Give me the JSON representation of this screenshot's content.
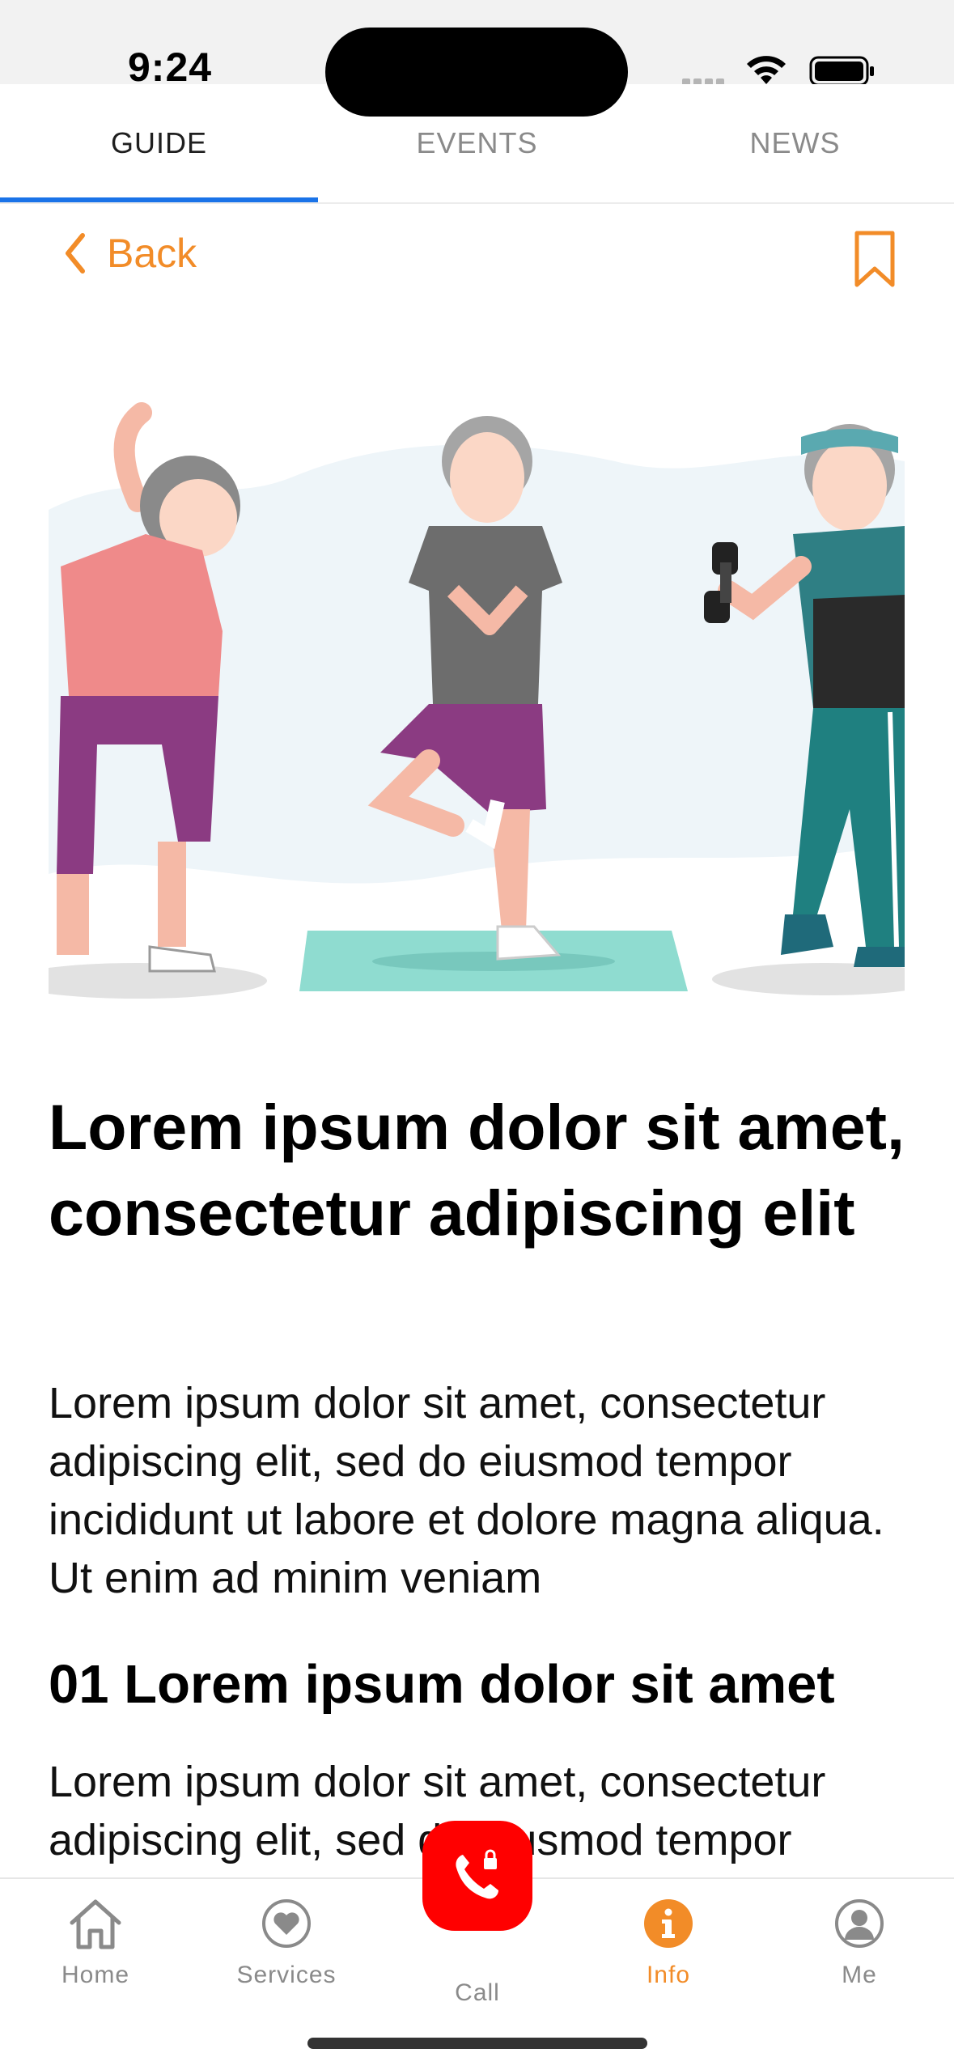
{
  "status_bar": {
    "time": "9:24"
  },
  "top_tabs": [
    {
      "label": "GUIDE",
      "active": true
    },
    {
      "label": "EVENTS",
      "active": false
    },
    {
      "label": "NEWS",
      "active": false
    }
  ],
  "nav": {
    "back_label": "Back",
    "accent_color": "#f28c28",
    "bookmark_icon": "bookmark-icon"
  },
  "article": {
    "title": "Lorem ipsum dolor sit amet, consectetur adipiscing elit",
    "paragraph1": "Lorem ipsum dolor sit amet, consectetur adipiscing elit, sed do eiusmod tempor incididunt ut labore et dolore magna aliqua. Ut enim ad minim veniam",
    "heading2": "01 Lorem ipsum dolor sit amet",
    "paragraph2": "Lorem ipsum dolor sit amet, consectetur adipiscing elit, sed do eiusmod tempor"
  },
  "bottom_nav": [
    {
      "label": "Home",
      "icon": "home-icon"
    },
    {
      "label": "Services",
      "icon": "heart-icon"
    },
    {
      "label": "Call",
      "icon": "phone-icon",
      "color": "#ff0000"
    },
    {
      "label": "Info",
      "icon": "info-icon",
      "active": true
    },
    {
      "label": "Me",
      "icon": "person-icon"
    }
  ]
}
